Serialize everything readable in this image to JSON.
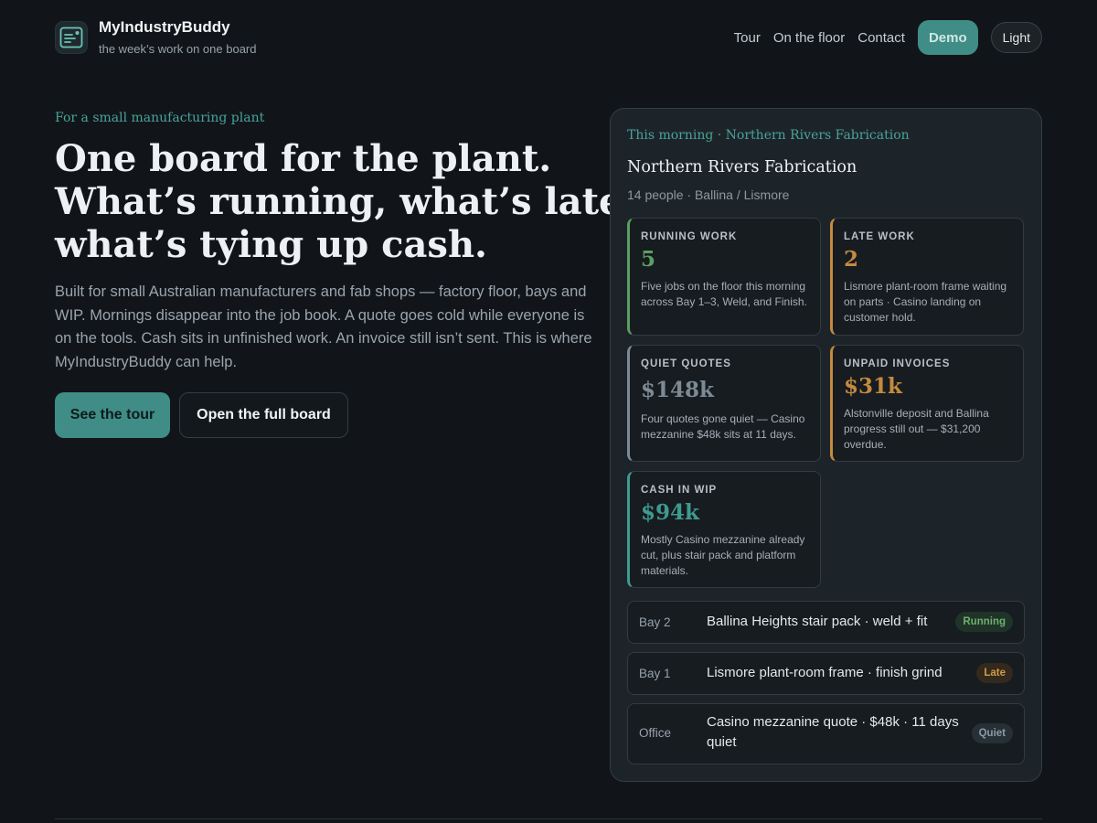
{
  "brand": {
    "name": "MyIndustryBuddy",
    "tagline": "the week’s work on one board"
  },
  "nav": {
    "links": [
      "Tour",
      "On the floor",
      "Contact"
    ],
    "demo_label": "Demo",
    "theme_label": "Light"
  },
  "hero": {
    "eyebrow": "For a small manufacturing plant",
    "headline": [
      "One board for the plant.",
      "What’s running, what’s late,",
      "what’s tying up cash."
    ],
    "lede": "Built for small Australian manufacturers and fab shops — factory floor, bays and WIP. Mornings disappear into the job book. A quote goes cold while everyone is on the tools. Cash sits in unfinished work. An invoice still isn’t sent. This is where MyIndustryBuddy can help.",
    "primary_cta": "See the tour",
    "secondary_cta": "Open the full board"
  },
  "board": {
    "eyebrow": "This morning · Northern Rivers Fabrication",
    "title": "Northern Rivers Fabrication",
    "subtitle": "14 people · Ballina / Lismore",
    "cards": [
      {
        "label": "RUNNING WORK",
        "value": "5",
        "description": "Five jobs on the floor this morning across Bay 1–3, Weld, and Finish.",
        "accent": "#5b9f61"
      },
      {
        "label": "LATE WORK",
        "value": "2",
        "description": "Lismore plant-room frame waiting on parts · Casino landing on customer hold.",
        "accent": "#c58a3e"
      },
      {
        "label": "QUIET QUOTES",
        "value": "$148k",
        "description": "Four quotes gone quiet — Casino mezzanine $48k sits at 11 days.",
        "accent": "#7d8a94"
      },
      {
        "label": "UNPAID INVOICES",
        "value": "$31k",
        "description": "Alstonville deposit and Ballina progress still out — $31,200 overdue.",
        "accent": "#c58a3e"
      },
      {
        "label": "CASH IN WIP",
        "value": "$94k",
        "description": "Mostly Casino mezzanine already cut, plus stair pack and platform materials.",
        "accent": "#3f9a91"
      }
    ],
    "rows": [
      {
        "location": "Bay 2",
        "text": "Ballina Heights stair pack · weld + fit",
        "status": "Running",
        "status_color": "#6fae6f",
        "status_bg": "#1f3328"
      },
      {
        "location": "Bay 1",
        "text": "Lismore plant-room frame · finish grind",
        "status": "Late",
        "status_color": "#d29a4a",
        "status_bg": "#33291c"
      },
      {
        "location": "Office",
        "text": "Casino mezzanine quote · $48k · 11 days quiet",
        "status": "Quiet",
        "status_color": "#8e9aa3",
        "status_bg": "#263036"
      }
    ]
  }
}
